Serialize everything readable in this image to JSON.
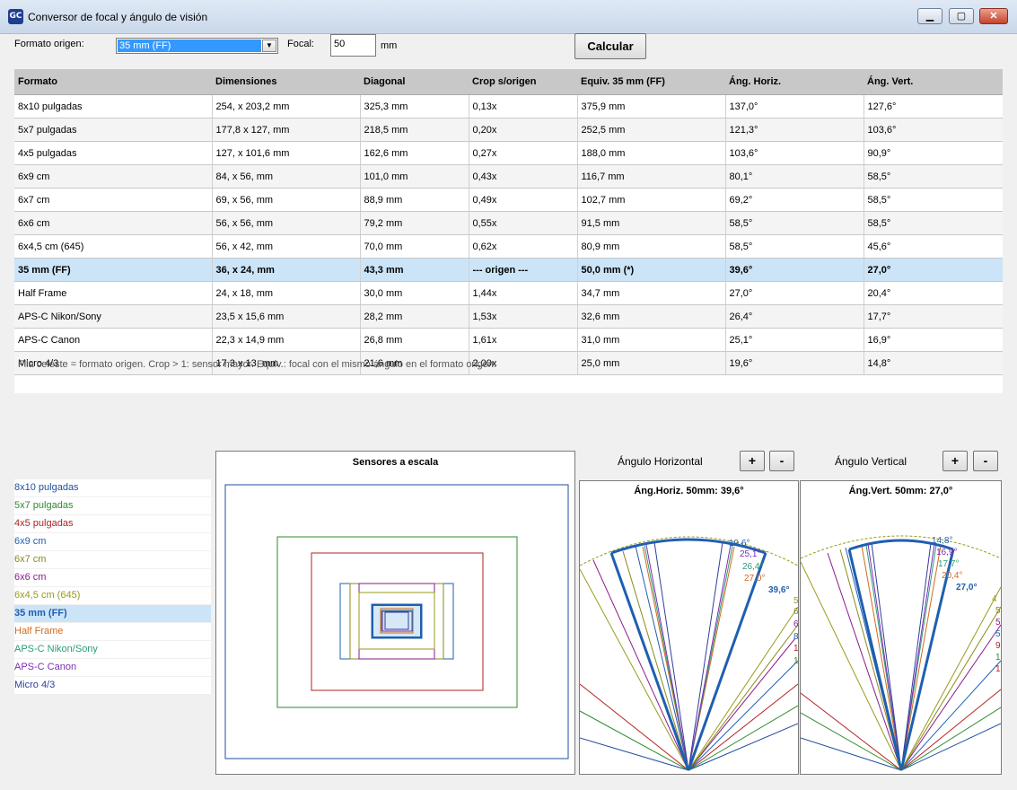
{
  "window": {
    "title": "Conversor de focal y ángulo de visión",
    "app_icon_text": "GC"
  },
  "toolbar": {
    "format_label": "Formato origen:",
    "format_selected": "35 mm (FF)",
    "focal_label": "Focal:",
    "focal_value": "50",
    "focal_unit": "mm",
    "calc_button": "Calcular"
  },
  "table": {
    "headers": [
      "Formato",
      "Dimensiones",
      "Diagonal",
      "Crop s/origen",
      "Equiv. 35 mm (FF)",
      "Áng. Horiz.",
      "Áng. Vert."
    ],
    "rows": [
      [
        "8x10 pulgadas",
        "254, x 203,2 mm",
        "325,3 mm",
        "0,13x",
        "375,9 mm",
        "137,0°",
        "127,6°"
      ],
      [
        "5x7 pulgadas",
        "177,8 x 127, mm",
        "218,5 mm",
        "0,20x",
        "252,5 mm",
        "121,3°",
        "103,6°"
      ],
      [
        "4x5 pulgadas",
        "127, x 101,6 mm",
        "162,6 mm",
        "0,27x",
        "188,0 mm",
        "103,6°",
        "90,9°"
      ],
      [
        "6x9 cm",
        "84, x 56, mm",
        "101,0 mm",
        "0,43x",
        "116,7 mm",
        "80,1°",
        "58,5°"
      ],
      [
        "6x7 cm",
        "69, x 56, mm",
        "88,9 mm",
        "0,49x",
        "102,7 mm",
        "69,2°",
        "58,5°"
      ],
      [
        "6x6 cm",
        "56, x 56, mm",
        "79,2 mm",
        "0,55x",
        "91,5 mm",
        "58,5°",
        "58,5°"
      ],
      [
        "6x4,5 cm (645)",
        "56, x 42, mm",
        "70,0 mm",
        "0,62x",
        "80,9 mm",
        "58,5°",
        "45,6°"
      ],
      [
        "35 mm (FF)",
        "36, x 24, mm",
        "43,3 mm",
        "--- origen ---",
        "50,0 mm (*)",
        "39,6°",
        "27,0°"
      ],
      [
        "Half Frame",
        "24, x 18, mm",
        "30,0 mm",
        "1,44x",
        "34,7 mm",
        "27,0°",
        "20,4°"
      ],
      [
        "APS-C Nikon/Sony",
        "23,5 x 15,6 mm",
        "28,2 mm",
        "1,53x",
        "32,6 mm",
        "26,4°",
        "17,7°"
      ],
      [
        "APS-C Canon",
        "22,3 x 14,9 mm",
        "26,8 mm",
        "1,61x",
        "31,0 mm",
        "25,1°",
        "16,9°"
      ],
      [
        "Micro 4/3",
        "17,3 x 13, mm",
        "21,6 mm",
        "2,00x",
        "25,0 mm",
        "19,6°",
        "14,8°"
      ]
    ],
    "highlight_row_index": 7,
    "note": "Fila celeste = formato origen.  Crop > 1: sensor mayor.  Equiv.: focal con el mismo ángulo en el formato origen."
  },
  "legend": {
    "items": [
      {
        "label": "8x10 pulgadas",
        "color": "#1f4e9c"
      },
      {
        "label": "5x7 pulgadas",
        "color": "#2e8b2e"
      },
      {
        "label": "4x5 pulgadas",
        "color": "#b22222"
      },
      {
        "label": "6x9 cm",
        "color": "#1f5fb0"
      },
      {
        "label": "6x7 cm",
        "color": "#8a8a1a"
      },
      {
        "label": "6x6 cm",
        "color": "#8b1a8b"
      },
      {
        "label": "6x4,5 cm (645)",
        "color": "#9a9a1a"
      },
      {
        "label": "35 mm (FF)",
        "color": "#1f5fb0"
      },
      {
        "label": "Half Frame",
        "color": "#d2691e"
      },
      {
        "label": "APS-C Nikon/Sony",
        "color": "#2e9b7b"
      },
      {
        "label": "APS-C Canon",
        "color": "#7b2eb0"
      },
      {
        "label": "Micro 4/3",
        "color": "#2e3e9c"
      }
    ]
  },
  "sensors_panel": {
    "title": "Sensores a escala"
  },
  "angle_h": {
    "header": "Ángulo Horizontal",
    "plus": "+",
    "minus": "-",
    "title": "Áng.Horiz. 50mm: 39,6°",
    "labels": [
      "19,6°",
      "25,1°",
      "26,4°",
      "27,0°",
      "39,6°"
    ],
    "edge_labels": [
      "5",
      "6",
      "6",
      "8",
      "1",
      "1"
    ]
  },
  "angle_v": {
    "header": "Ángulo Vertical",
    "plus": "+",
    "minus": "-",
    "title": "Áng.Vert. 50mm: 27,0°",
    "labels": [
      "14,8°",
      "16,9°",
      "17,7°",
      "20,4°",
      "27,0°"
    ],
    "edge_labels": [
      "4",
      "5",
      "5",
      "5",
      "9",
      "1",
      "1"
    ]
  },
  "colors": {
    "highlight_row": "#cce4f7",
    "selection_blue": "#3399ff"
  }
}
